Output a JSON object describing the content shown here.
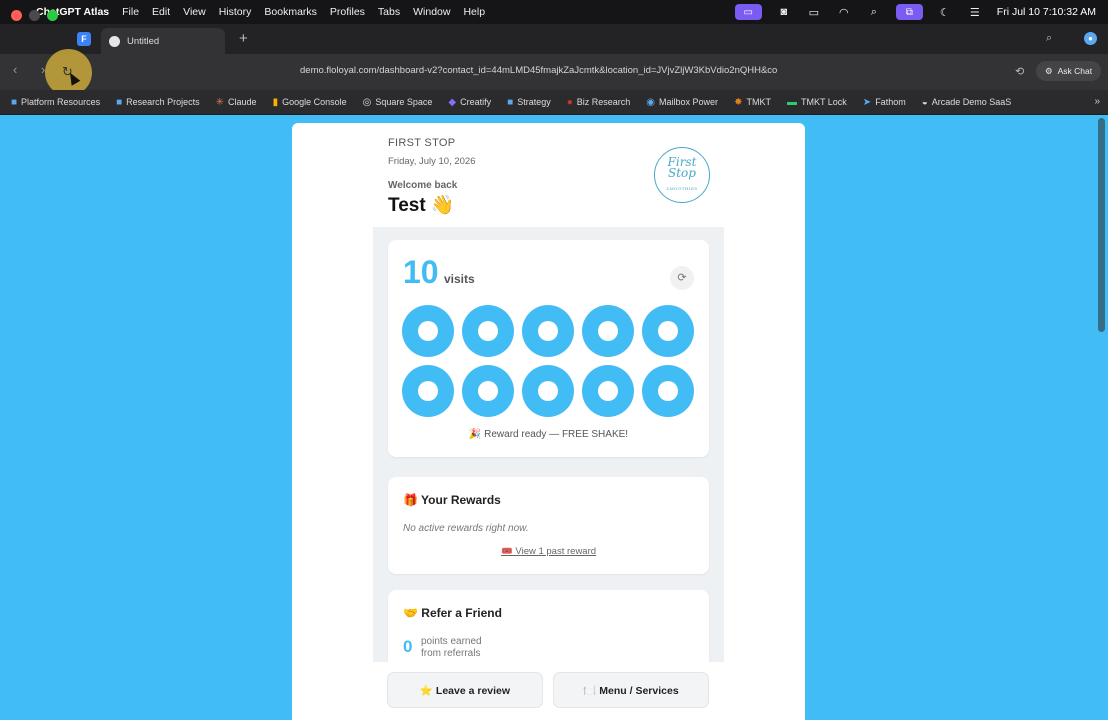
{
  "menubar": {
    "app_name": "ChatGPT Atlas",
    "menus": [
      "File",
      "Edit",
      "View",
      "History",
      "Bookmarks",
      "Profiles",
      "Tabs",
      "Window",
      "Help"
    ],
    "clock": "Fri Jul 10  7:10:32 AM"
  },
  "tabs": [
    {
      "title": "Untitled"
    }
  ],
  "toolbar": {
    "url": "demo.floloyal.com/dashboard-v2?contact_id=44mLMD45fmajkZaJcmtk&location_id=JVjvZljW3KbVdio2nQHH&co",
    "ask_chat": "Ask Chat"
  },
  "bookmarks": [
    {
      "label": "Platform Resources",
      "icon": "folder-icon"
    },
    {
      "label": "Research Projects",
      "icon": "folder-icon"
    },
    {
      "label": "Claude",
      "icon": "claude-icon"
    },
    {
      "label": "Google Console",
      "icon": "chart-icon"
    },
    {
      "label": "Square Space",
      "icon": "squarespace-icon"
    },
    {
      "label": "Creatify",
      "icon": "creatify-icon"
    },
    {
      "label": "Strategy",
      "icon": "folder-icon"
    },
    {
      "label": "Biz Research",
      "icon": "biz-icon"
    },
    {
      "label": "Mailbox Power",
      "icon": "mailbox-icon"
    },
    {
      "label": "TMKT",
      "icon": "tmkt-icon"
    },
    {
      "label": "TMKT Lock",
      "icon": "tmkt-lock-icon"
    },
    {
      "label": "Fathom",
      "icon": "fathom-icon"
    },
    {
      "label": "Arcade Demo SaaS",
      "icon": "arcade-icon"
    }
  ],
  "page": {
    "business": "FIRST STOP",
    "date": "Friday, July 10, 2026",
    "welcome": "Welcome back",
    "name": "Test 👋",
    "logo_text_1": "First",
    "logo_text_2": "Stop",
    "logo_sub": "SMOOTHIES",
    "visits": {
      "count": "10",
      "label": "visits",
      "stamps_filled": 10,
      "stamps_total": 10,
      "reward_ready": "🎉 Reward ready — FREE SHAKE!"
    },
    "rewards": {
      "title": "🎁 Your Rewards",
      "empty": "No active rewards right now.",
      "past_link": "🎟️ View 1 past reward"
    },
    "refer": {
      "title": "🤝 Refer a Friend",
      "points": "0",
      "points_label_1": "points earned",
      "points_label_2": "from referrals"
    },
    "buttons": {
      "review": "⭐ Leave a review",
      "menu": "🍽️ Menu / Services"
    }
  },
  "colors": {
    "accent": "#42bcf5",
    "reload_highlight": "#c9a83a"
  }
}
